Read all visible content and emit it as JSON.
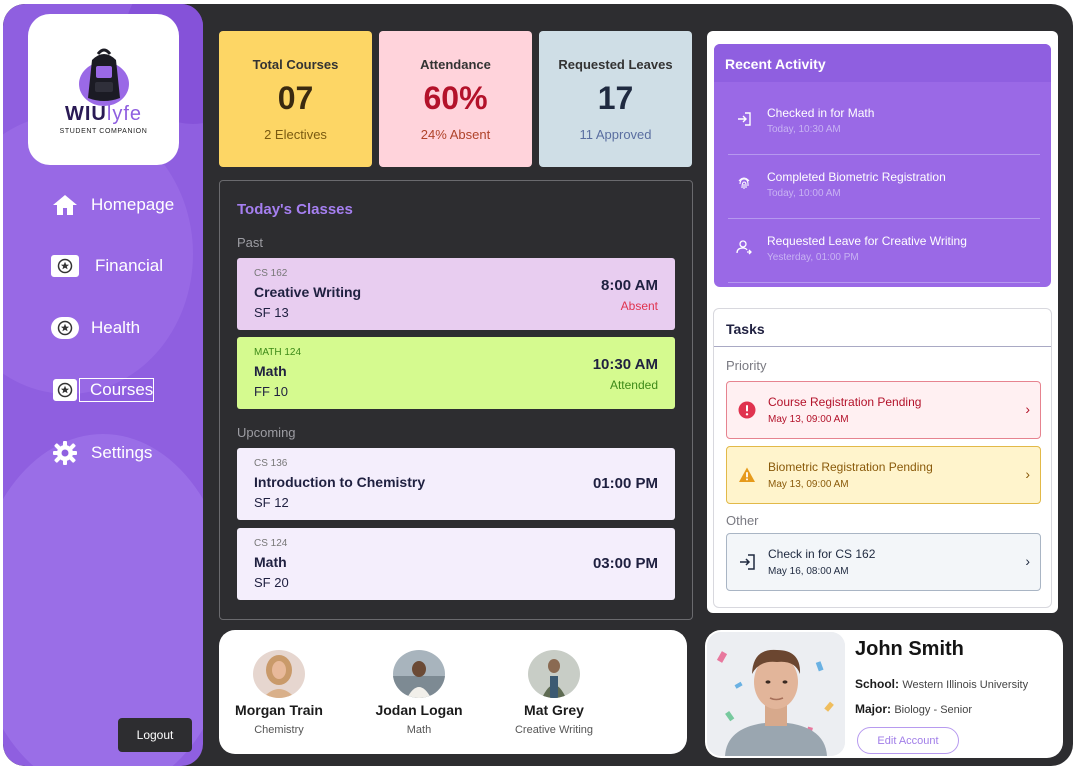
{
  "brand": {
    "word_main": "WIU",
    "word_accent": "lyfe",
    "tagline": "STUDENT COMPANION"
  },
  "sidebar": {
    "items": [
      {
        "label": "Homepage",
        "icon": "home-icon"
      },
      {
        "label": "Financial",
        "icon": "star-badge-icon"
      },
      {
        "label": "Health",
        "icon": "star-badge-icon"
      },
      {
        "label": "Courses",
        "icon": "star-badge-icon"
      },
      {
        "label": "Settings",
        "icon": "gear-icon"
      }
    ],
    "logout_label": "Logout"
  },
  "stats": [
    {
      "label": "Total Courses",
      "value": "07",
      "sub": "2 Electives",
      "bg": "#fdd665",
      "value_color": "#3a2a10",
      "sub_color": "#7a5a10"
    },
    {
      "label": "Attendance",
      "value": "60%",
      "sub": "24% Absent",
      "bg": "#ffd3db",
      "value_color": "#b3122a",
      "sub_color": "#b0432a"
    },
    {
      "label": "Requested Leaves",
      "value": "17",
      "sub": "11 Approved",
      "bg": "#cfdee6",
      "value_color": "#1f2a40",
      "sub_color": "#5a6ea0"
    }
  ],
  "classes": {
    "title": "Today's Classes",
    "past_label": "Past",
    "upcoming_label": "Upcoming",
    "past": [
      {
        "code": "CS 162",
        "name": "Creative Writing",
        "room": "SF 13",
        "time": "8:00 AM",
        "status": "Absent",
        "bg": "#e8cdf0",
        "status_color": "#e0334f",
        "code_color": "#777777"
      },
      {
        "code": "MATH 124",
        "name": "Math",
        "room": "FF 10",
        "time": "10:30 AM",
        "status": "Attended",
        "bg": "#d5fa8f",
        "status_color": "#3d8a18",
        "code_color": "#3d8a18"
      }
    ],
    "upcoming": [
      {
        "code": "CS 136",
        "name": "Introduction to Chemistry",
        "room": "SF 12",
        "time": "01:00 PM",
        "bg": "#f4eefc"
      },
      {
        "code": "CS 124",
        "name": "Math",
        "room": "SF 20",
        "time": "03:00 PM",
        "bg": "#f4eefc"
      }
    ]
  },
  "activity": {
    "title": "Recent Activity",
    "items": [
      {
        "text": "Checked in for Math",
        "time": "Today, 10:30 AM",
        "icon": "check-in-icon"
      },
      {
        "text": "Completed Biometric Registration",
        "time": "Today, 10:00 AM",
        "icon": "fingerprint-icon"
      },
      {
        "text": "Requested Leave for Creative Writing",
        "time": "Yesterday, 01:00 PM",
        "icon": "user-request-icon"
      }
    ]
  },
  "tasks": {
    "title": "Tasks",
    "priority_label": "Priority",
    "other_label": "Other",
    "priority": [
      {
        "text": "Course Registration Pending",
        "time": "May 13, 09:00 AM",
        "bg": "#fff0f2",
        "border": "#e6838f",
        "text_color": "#b3122a",
        "icon": "alert-circle-icon"
      },
      {
        "text": "Biometric Registration Pending",
        "time": "May 13, 09:00 AM",
        "bg": "#fff4cc",
        "border": "#e2b948",
        "text_color": "#8a5a0a",
        "icon": "warning-triangle-icon"
      }
    ],
    "other": [
      {
        "text": "Check in for CS 162",
        "time": "May 16, 08:00 AM",
        "bg": "#f3f6f9",
        "border": "#a9b5c4",
        "text_color": "#1f2a40",
        "icon": "check-in-icon"
      }
    ]
  },
  "people": [
    {
      "name": "Morgan Train",
      "subject": "Chemistry"
    },
    {
      "name": "Jodan Logan",
      "subject": "Math"
    },
    {
      "name": "Mat Grey",
      "subject": "Creative Writing"
    }
  ],
  "profile": {
    "name": "John Smith",
    "school_label": "School:",
    "school": "Western Illinois University",
    "major_label": "Major:",
    "major": "Biology - Senior",
    "edit_label": "Edit Account"
  }
}
